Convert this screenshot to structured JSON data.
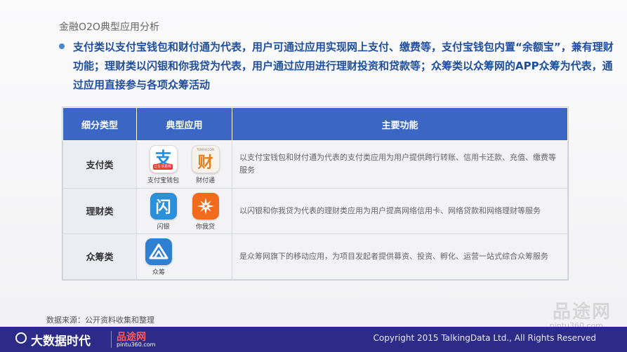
{
  "header": {
    "title": "金融O2O典型应用分析",
    "bullet": "支付类以支付宝钱包和财付通为代表，用户可通过应用实现网上支付、缴费等，支付宝钱包内置“余额宝”，兼有理财功能；理财类以闪银和你我贷为代表，用户通过应用进行理财投资和贷款等；众筹类以众筹网的APP众筹为代表，通过应用直接参与各项众筹活动"
  },
  "table": {
    "headers": [
      "细分类型",
      "典型应用",
      "主要功能"
    ],
    "rows": [
      {
        "category": "支付类",
        "apps": [
          {
            "name": "支付宝钱包",
            "icon": "alipay-icon"
          },
          {
            "name": "财付通",
            "icon": "tenpay-icon"
          }
        ],
        "function": "以支付宝钱包和财付通为代表的支付类应用为用户提供跨行转账、信用卡还款、充值、缴费等服务"
      },
      {
        "category": "理财类",
        "apps": [
          {
            "name": "闪银",
            "icon": "shanyin-icon"
          },
          {
            "name": "你我贷",
            "icon": "niwodai-icon"
          }
        ],
        "function": "以闪银和你我贷为代表的理财类应用为用户提高网络信用卡、网络贷款和网络理财等服务"
      },
      {
        "category": "众筹类",
        "apps": [
          {
            "name": "众筹",
            "icon": "zhongchou-icon"
          }
        ],
        "function": "是众筹网旗下的移动应用，为项目发起者提供募资、投资、孵化、运营一站式综合众筹服务"
      }
    ]
  },
  "icon_text": {
    "alipay_glyph": "支",
    "alipay_band": "让生活更简单",
    "tenpay_glyph": "财",
    "tenpay_top": "TENPAY.COM",
    "shanyin_glyph": "闪"
  },
  "footer": {
    "source": "数据来源：公开资料收集和整理",
    "logo": "大数据时代",
    "brand": "品途网",
    "brand_url": "pintu360.com",
    "copyright": "Copyright 2015 TalkingData Ltd., All Rights Reserved",
    "watermark": "品途网",
    "watermark_url": "pintu360.com"
  },
  "colors": {
    "header_bg": "#3c66c4",
    "bullet_text": "#1f4e9c",
    "footer_bg": "#2c2c88",
    "brand_red": "#ff5858"
  }
}
